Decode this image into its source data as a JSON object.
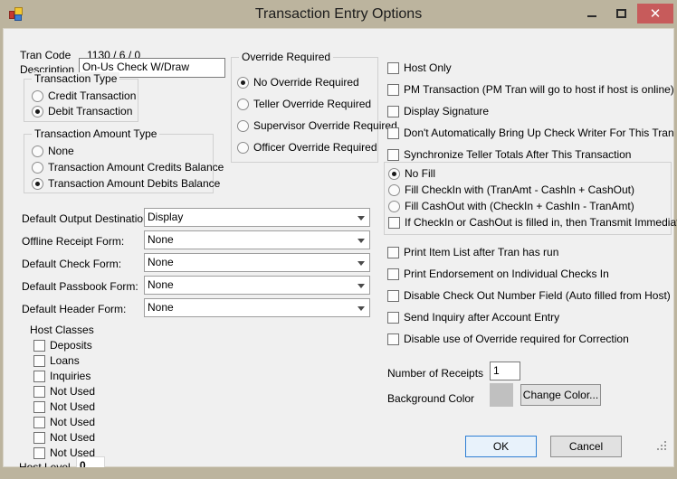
{
  "window": {
    "title": "Transaction Entry Options",
    "icon": "app-icon",
    "minimize_label": "Minimize",
    "maximize_label": "Maximize",
    "close_label": "Close",
    "close_color": "#c75b5b",
    "titlebar_color": "#bcb49e",
    "client_color": "#f0f0f0"
  },
  "tran_code": {
    "label": "Tran Code",
    "value": "1130 / 6 / 0"
  },
  "description": {
    "label": "Description",
    "value": "On-Us Check W/Draw"
  },
  "transaction_type": {
    "title": "Transaction Type",
    "options": [
      {
        "label": "Credit Transaction",
        "selected": false
      },
      {
        "label": "Debit Transaction",
        "selected": true
      }
    ]
  },
  "transaction_amount_type": {
    "title": "Transaction Amount Type",
    "options": [
      {
        "label": "None",
        "selected": false
      },
      {
        "label": "Transaction Amount Credits Balance",
        "selected": false
      },
      {
        "label": "Transaction Amount Debits Balance",
        "selected": true
      }
    ]
  },
  "override_required": {
    "title": "Override Required",
    "options": [
      {
        "label": "No Override Required",
        "selected": true
      },
      {
        "label": "Teller Override Required",
        "selected": false
      },
      {
        "label": "Supervisor Override Required",
        "selected": false
      },
      {
        "label": "Officer Override Required",
        "selected": false
      }
    ]
  },
  "forms": [
    {
      "label": "Default Output Destination:",
      "value": "Display"
    },
    {
      "label": "Offline Receipt Form:",
      "value": "None"
    },
    {
      "label": "Default Check Form:",
      "value": "None"
    },
    {
      "label": "Default Passbook Form:",
      "value": "None"
    },
    {
      "label": "Default Header Form:",
      "value": "None"
    }
  ],
  "host_classes": {
    "title": "Host Classes",
    "items": [
      {
        "label": "Deposits",
        "checked": false
      },
      {
        "label": "Loans",
        "checked": false
      },
      {
        "label": "Inquiries",
        "checked": false
      },
      {
        "label": "Not Used",
        "checked": false
      },
      {
        "label": "Not Used",
        "checked": false
      },
      {
        "label": "Not Used",
        "checked": false
      },
      {
        "label": "Not Used",
        "checked": false
      },
      {
        "label": "Not Used",
        "checked": false
      }
    ]
  },
  "host_level": {
    "label": "Host Level",
    "value": "0"
  },
  "right_options_top": [
    {
      "label": "Host Only",
      "checked": false
    },
    {
      "label": "PM Transaction (PM Tran will go to host if host is online)",
      "checked": false
    },
    {
      "label": "Display Signature",
      "checked": false
    },
    {
      "label": "Don't Automatically Bring Up Check Writer For This Tran",
      "checked": false
    },
    {
      "label": "Synchronize Teller Totals After This Transaction",
      "checked": false
    }
  ],
  "fill_group": {
    "radios": [
      {
        "label": "No Fill",
        "selected": true
      },
      {
        "label": "Fill CheckIn with (TranAmt - CashIn + CashOut)",
        "selected": false
      },
      {
        "label": "Fill CashOut with (CheckIn + CashIn - TranAmt)",
        "selected": false
      }
    ],
    "checkbox": {
      "label": "If CheckIn or CashOut is filled in, then Transmit Immediately",
      "checked": false
    }
  },
  "right_options_bottom": [
    {
      "label": "Print Item List after Tran has run",
      "checked": false
    },
    {
      "label": "Print Endorsement on Individual Checks In",
      "checked": false
    },
    {
      "label": "Disable Check Out Number Field (Auto filled from Host)",
      "checked": false
    },
    {
      "label": "Send Inquiry after Account Entry",
      "checked": false
    },
    {
      "label": "Disable use of Override required for Correction",
      "checked": false
    }
  ],
  "number_of_receipts": {
    "label": "Number of Receipts",
    "value": "1"
  },
  "background_color": {
    "label": "Background Color",
    "swatch_color": "#c0c0c0",
    "button_label": "Change Color..."
  },
  "footer": {
    "ok_label": "OK",
    "cancel_label": "Cancel"
  }
}
